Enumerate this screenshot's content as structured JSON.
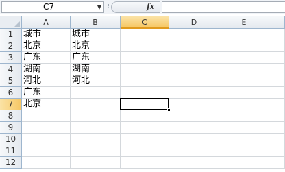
{
  "formula_bar": {
    "name_box": "C7",
    "name_box_arrow": "▼",
    "splitter": "⁝",
    "fx_label": "fx",
    "formula": ""
  },
  "columns": [
    "A",
    "B",
    "C",
    "D",
    "E"
  ],
  "rows": [
    "1",
    "2",
    "3",
    "4",
    "5",
    "6",
    "7",
    "8",
    "9",
    "10",
    "11",
    "12"
  ],
  "selected_cell": "C7",
  "cells": {
    "A1": "城市",
    "B1": "城市",
    "A2": "北京",
    "B2": "北京",
    "A3": "广东",
    "B3": "广东",
    "A4": "湖南",
    "B4": "湖南",
    "A5": "河北",
    "B5": "河北",
    "A6": "广东",
    "A7": "北京"
  }
}
